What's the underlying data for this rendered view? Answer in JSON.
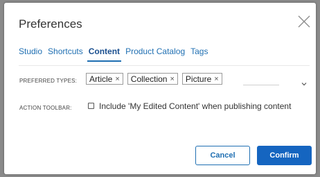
{
  "dialog": {
    "title": "Preferences",
    "close_icon": "close-icon"
  },
  "tabs": [
    {
      "label": "Studio",
      "active": false
    },
    {
      "label": "Shortcuts",
      "active": false
    },
    {
      "label": "Content",
      "active": true
    },
    {
      "label": "Product Catalog",
      "active": false
    },
    {
      "label": "Tags",
      "active": false
    }
  ],
  "preferred_types": {
    "label": "PREFERRED TYPES:",
    "chips": [
      "Article",
      "Collection",
      "Picture"
    ],
    "remove_glyph": "×",
    "dropdown_icon": "chevron-down-icon"
  },
  "action_toolbar": {
    "label": "ACTION TOOLBAR:",
    "checkbox_label": "Include 'My Edited Content' when publishing content",
    "checked": false
  },
  "buttons": {
    "cancel": "Cancel",
    "confirm": "Confirm"
  },
  "colors": {
    "accent": "#1f6fb2",
    "primary_button": "#1565c0",
    "backdrop": "#8a8a8a"
  }
}
